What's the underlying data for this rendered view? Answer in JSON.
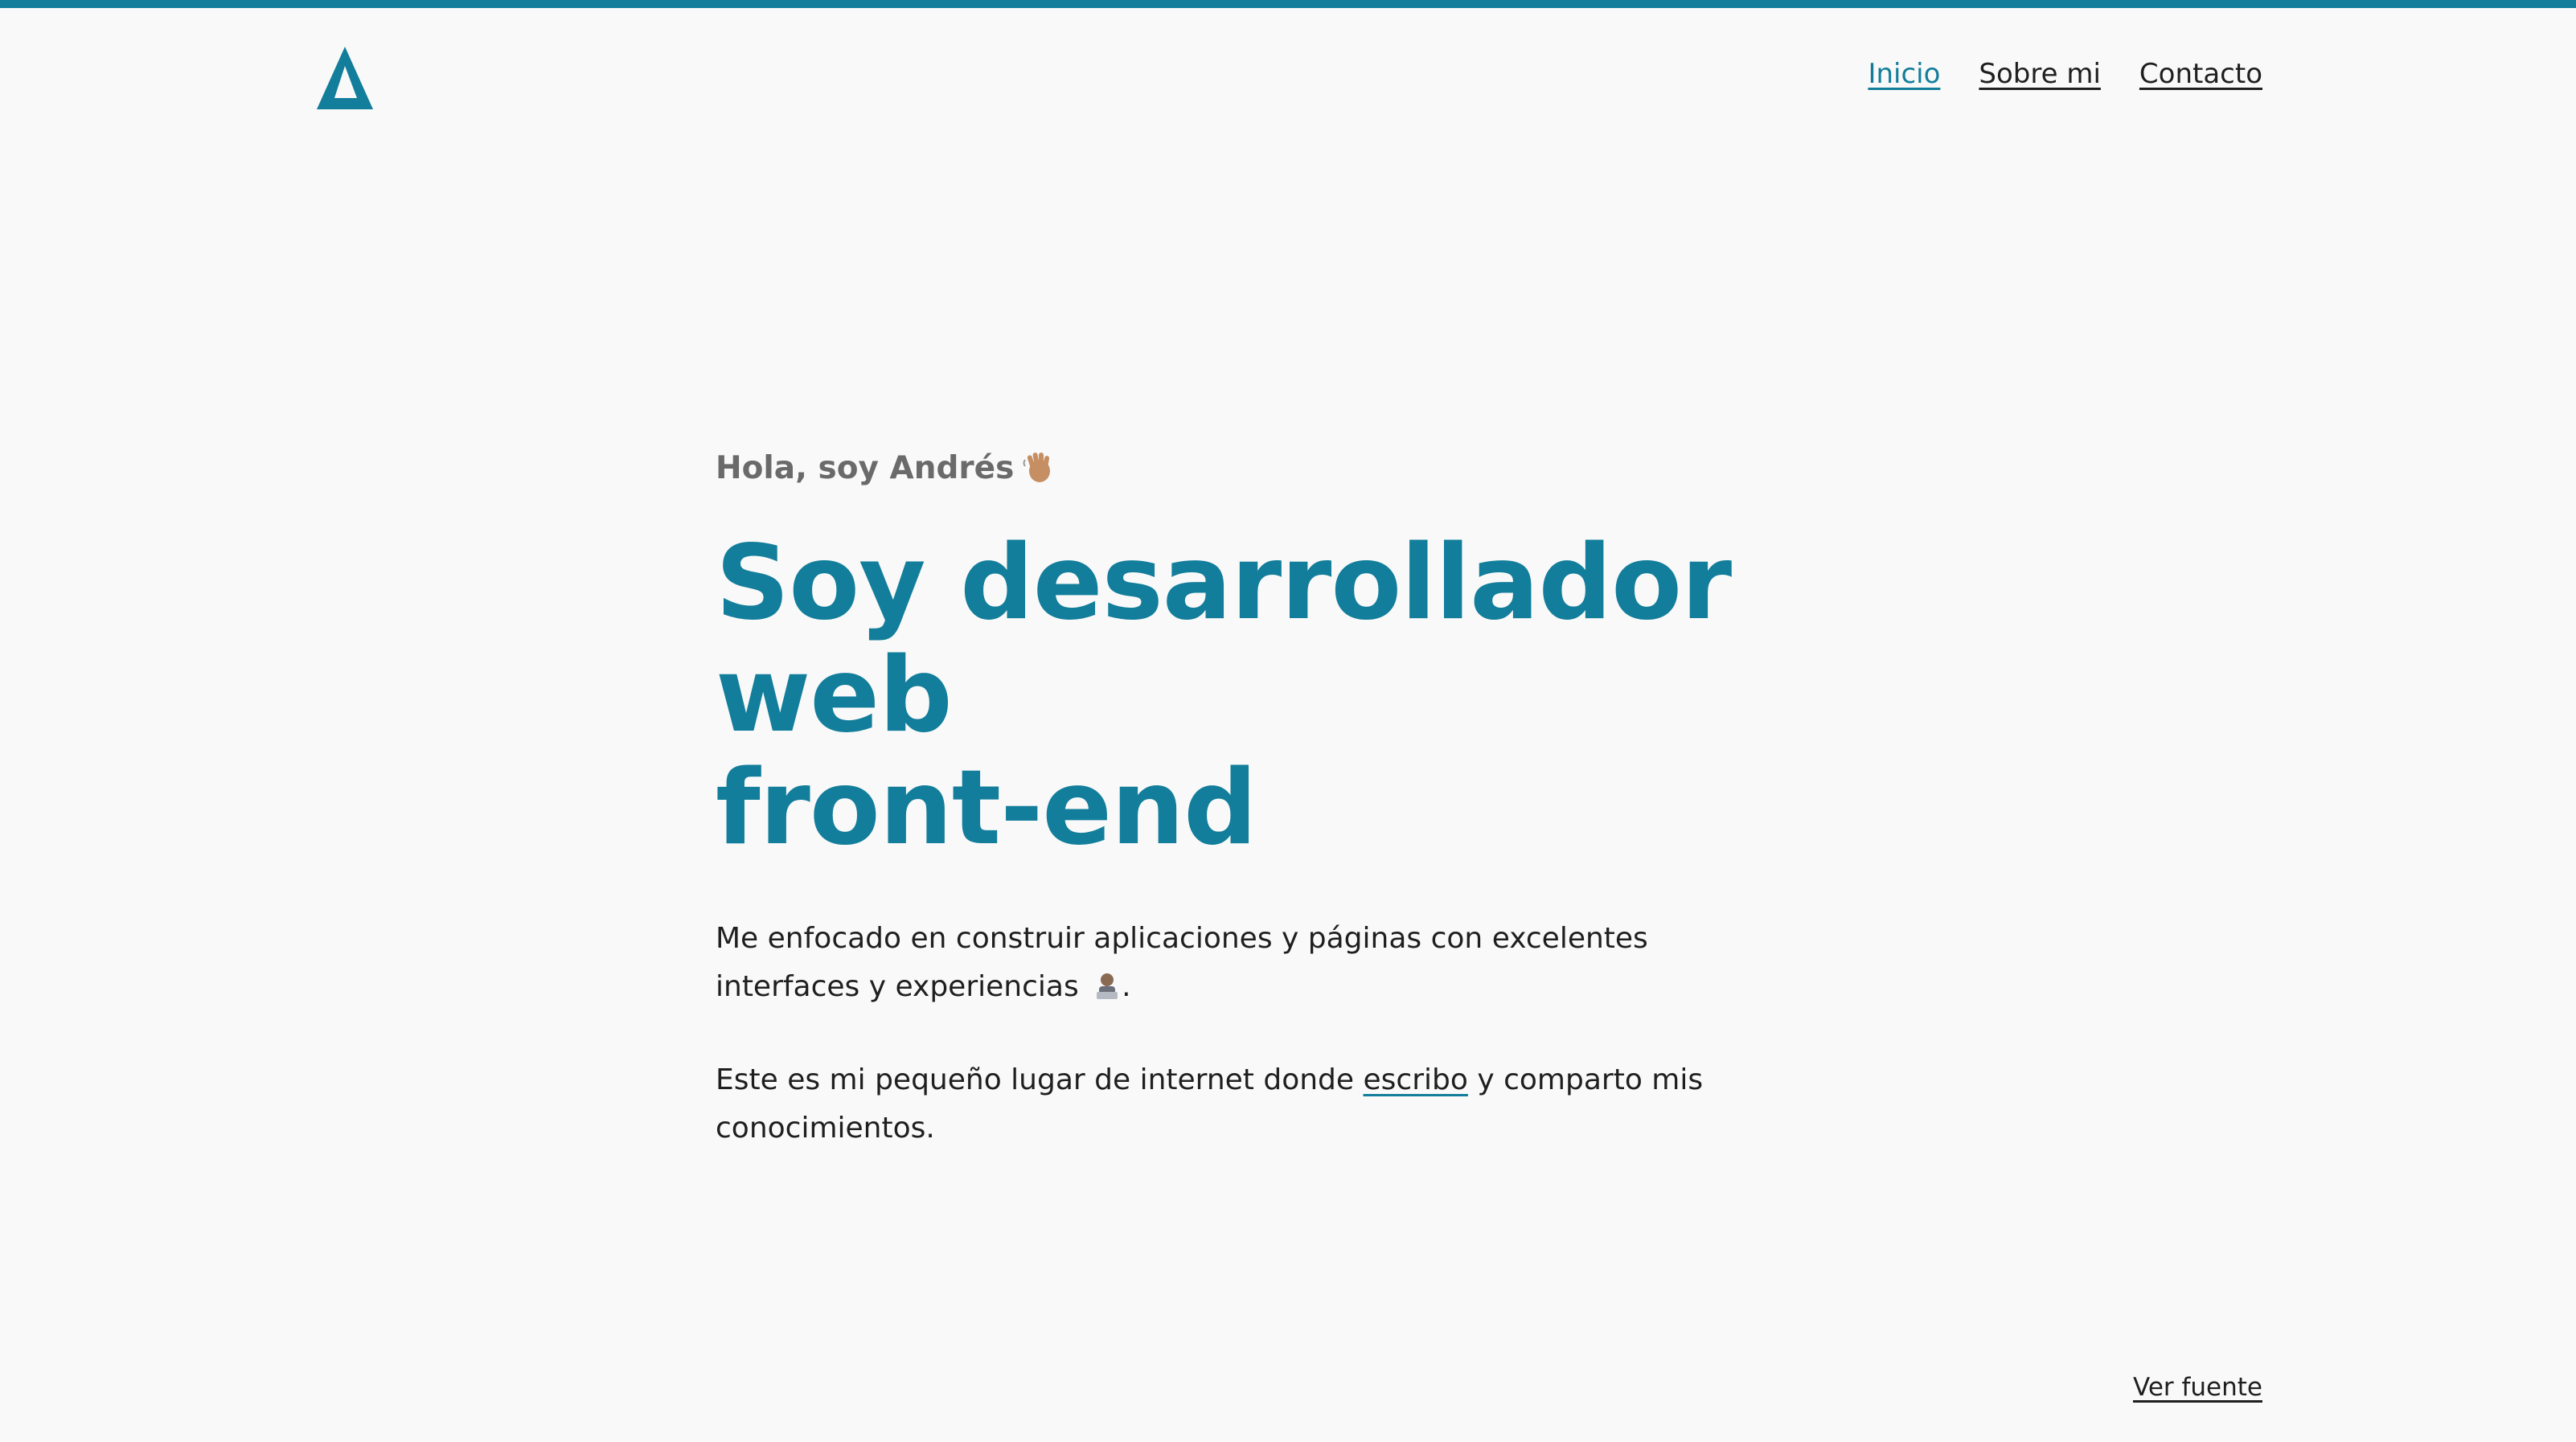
{
  "colors": {
    "accent": "#127e9b",
    "background": "#f9f9f9",
    "text": "#1f1f1f",
    "muted": "#6a6a6a"
  },
  "header": {
    "logo_icon": "triangle-logo-icon",
    "nav": {
      "home": "Inicio",
      "about": "Sobre mi",
      "contact": "Contacto"
    }
  },
  "hero": {
    "greeting": "Hola, soy Andrés",
    "greeting_emoji": "waving-hand-icon",
    "headline_line1": "Soy desarrollador web",
    "headline_line2": "front-end",
    "intro_text": "Me enfocado en construir aplicaciones y páginas con excelentes interfaces y experiencias",
    "intro_emoji": "person-at-laptop-icon",
    "intro_end": ".",
    "blog_text_before": "Este es mi pequeño lugar de internet donde",
    "blog_link": "escribo",
    "blog_text_after": "y comparto mis conocimientos."
  },
  "footer": {
    "source_link": "Ver fuente"
  }
}
